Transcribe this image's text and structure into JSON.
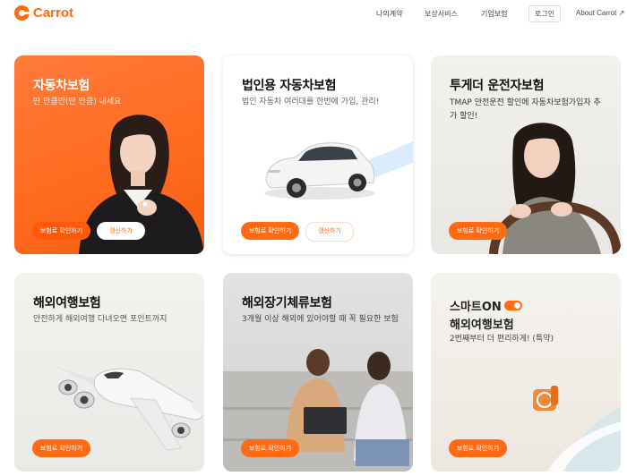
{
  "header": {
    "logo_text": "Carrot",
    "nav": [
      "나의계약",
      "보상서비스",
      "기업보험"
    ],
    "login_label": "로그인",
    "about_label": "About Carrot",
    "about_icon": "arrow-up-right-icon"
  },
  "cards": [
    {
      "title": "자동차보험",
      "subtitle": "딴 만큼만(탄 만큼) 내세요",
      "primary_button": "보험료 확인하기",
      "secondary_button": "갱신하기",
      "background": "#ff6a1e"
    },
    {
      "title": "법인용 자동차보험",
      "subtitle": "법인 자동차 여러대를 한번에 가입, 관리!",
      "primary_button": "보험료 확인하기",
      "secondary_button": "갱신하기"
    },
    {
      "title": "투게더 운전자보험",
      "subtitle": "TMAP 안전운전 할인에 자동차보험가입자 추가 할인!",
      "primary_button": "보험료 확인하기"
    },
    {
      "title": "해외여행보험",
      "subtitle": "안전하게 해외여행 다녀오면 포인트까지",
      "primary_button": "보험료 확인하기"
    },
    {
      "title": "해외장기체류보험",
      "subtitle": "3개월 이상 해외에 있어야할 때 꼭 필요한 보험",
      "primary_button": "보험료 확인하기"
    },
    {
      "title_prefix": "스마트ON",
      "title": "해외여행보험",
      "subtitle": "2번째부터 더 편리하게! (특약)",
      "primary_button": "보험료 확인하기"
    }
  ],
  "colors": {
    "brand": "#ff6a13",
    "text": "#222222"
  }
}
